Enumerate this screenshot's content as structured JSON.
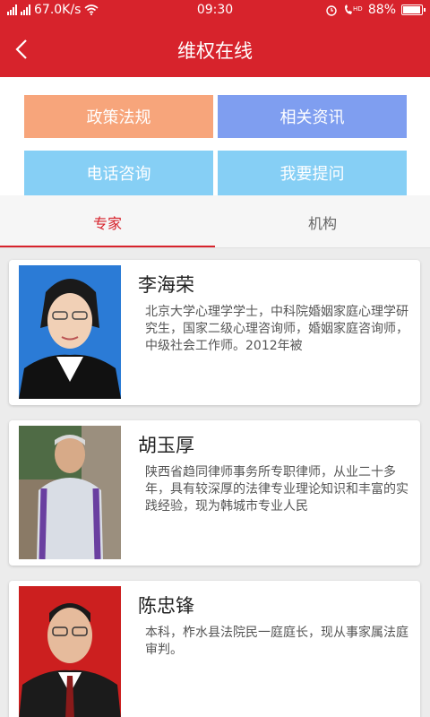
{
  "status_bar": {
    "network_speed": "67.0K/s",
    "time": "09:30",
    "battery": "88%",
    "icons": [
      "signal-icon",
      "signal-4g-icon",
      "wifi-icon",
      "alarm-icon",
      "volte-icon",
      "battery-icon"
    ]
  },
  "header": {
    "title": "维权在线",
    "back_icon": "back-arrow-icon"
  },
  "grid": {
    "items": [
      {
        "label": "政策法规",
        "color": "#f7a57b"
      },
      {
        "label": "相关资讯",
        "color": "#7f9ef0"
      },
      {
        "label": "电话咨询",
        "color": "#86cff5"
      },
      {
        "label": "我要提问",
        "color": "#86cff5"
      }
    ]
  },
  "tabs": [
    {
      "label": "专家",
      "active": true
    },
    {
      "label": "机构",
      "active": false
    }
  ],
  "experts": [
    {
      "name": "李海荣",
      "desc": "北京大学心理学学士，中科院婚姻家庭心理学研究生，国家二级心理咨询师，婚姻家庭咨询师，中级社会工作师。2012年被"
    },
    {
      "name": "胡玉厚",
      "desc": "陕西省趋同律师事务所专职律师，从业二十多年，具有较深厚的法律专业理论知识和丰富的实践经验，现为韩城市专业人民"
    },
    {
      "name": "陈忠锋",
      "desc": "本科，柞水县法院民一庭庭长，现从事家属法庭审判。"
    }
  ],
  "colors": {
    "primary": "#d7232c",
    "tab_active": "#d7232c"
  }
}
